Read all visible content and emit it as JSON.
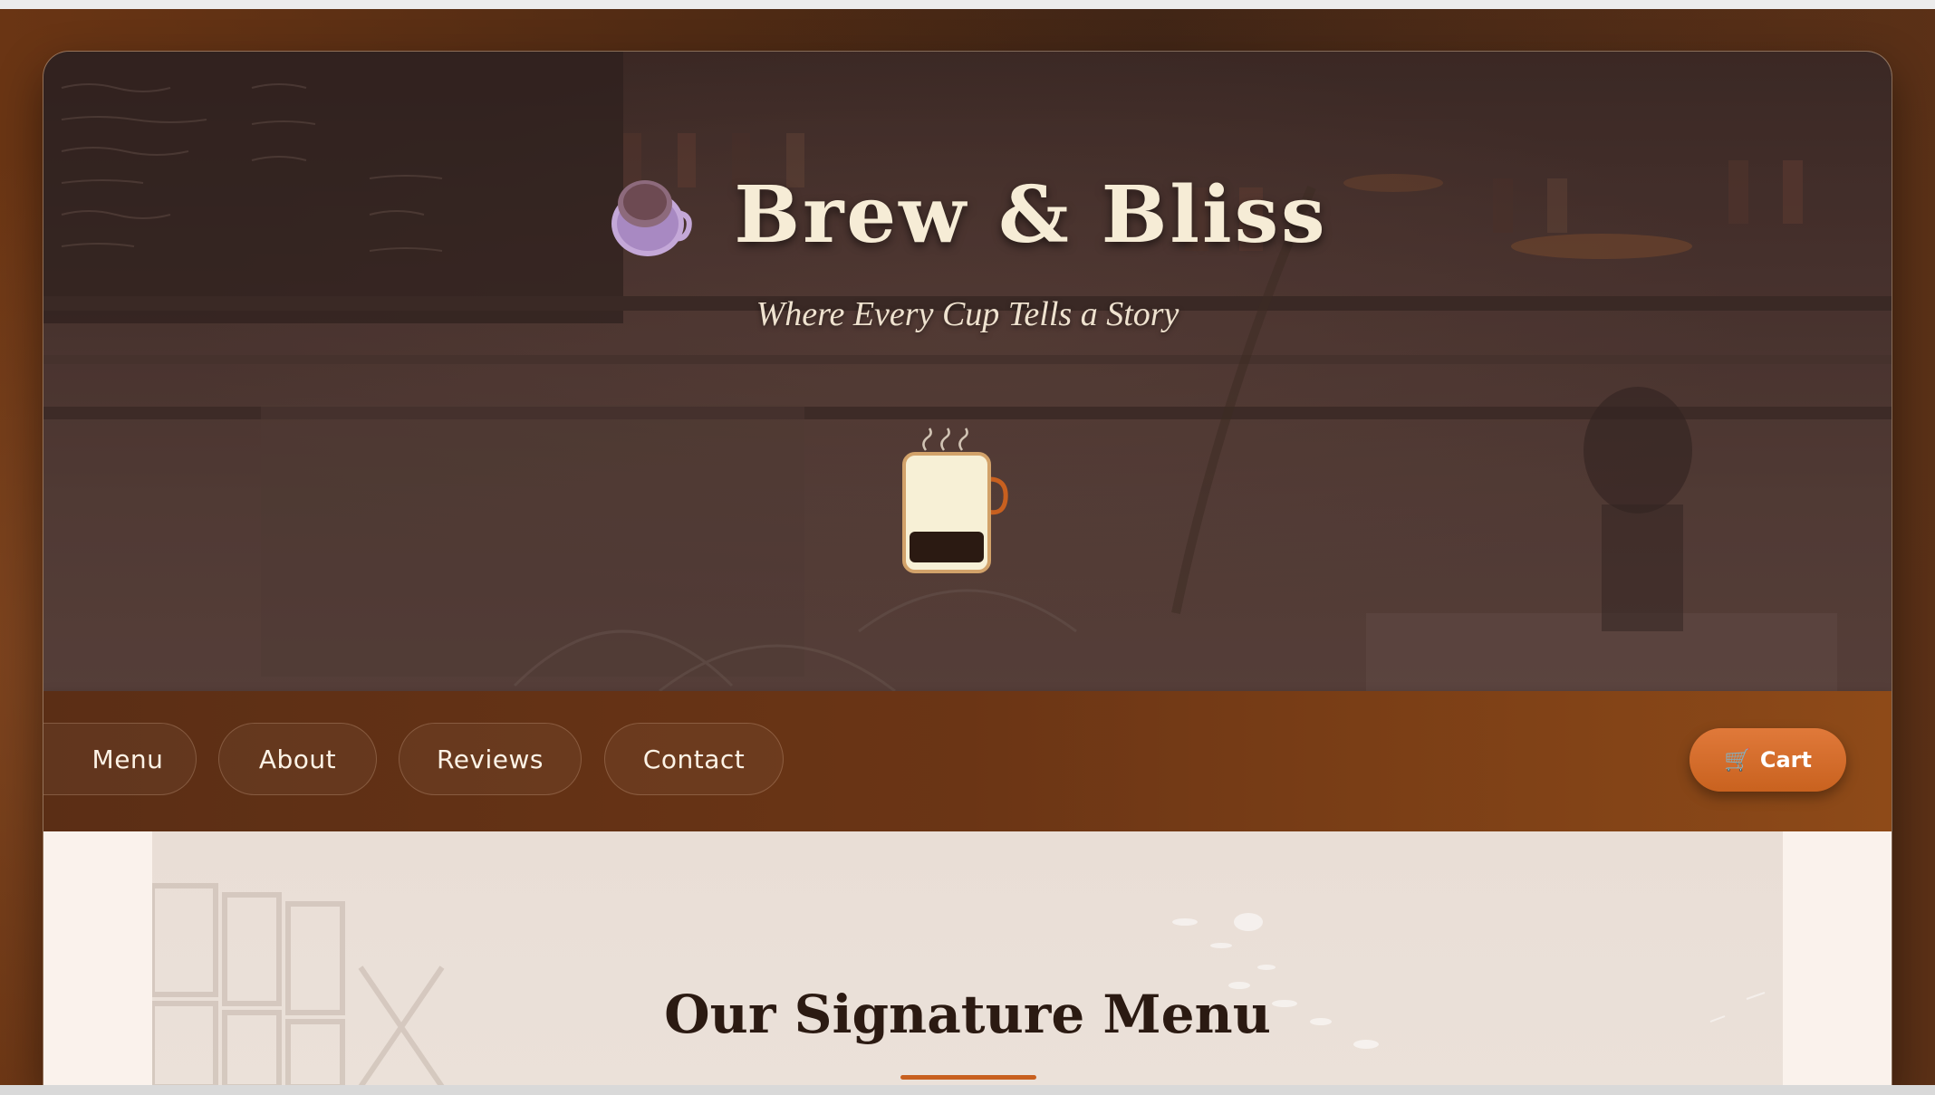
{
  "brand": {
    "name": "Brew & Bliss",
    "tagline": "Where Every Cup Tells a Story"
  },
  "nav": {
    "items": [
      {
        "label": "Menu"
      },
      {
        "label": "About"
      },
      {
        "label": "Reviews"
      },
      {
        "label": "Contact"
      }
    ],
    "cart": {
      "label": "Cart",
      "icon": "shopping-cart-icon"
    }
  },
  "menu_section": {
    "title": "Our Signature Menu"
  },
  "colors": {
    "accent": "#c9621f",
    "nav_start": "#5b2e15",
    "nav_end": "#8e4a18",
    "title_cream": "#f6ecd6",
    "heading_dark": "#2b1a12"
  }
}
